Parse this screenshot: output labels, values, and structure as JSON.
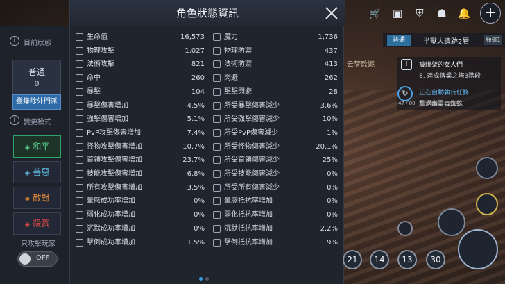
{
  "dialog": {
    "title": "角色狀態資訊",
    "page_dots": 2,
    "active_page": 0
  },
  "left_panel": {
    "status_title": "目前狀態",
    "status_mode": "普通",
    "status_count": "0",
    "register_button": "登錄除外門派",
    "change_mode_title": "變更模式",
    "modes": [
      {
        "label": "和平",
        "color": "#5fd08f",
        "selected": true
      },
      {
        "label": "善惡",
        "color": "#5fb8e0",
        "selected": false
      },
      {
        "label": "敵對",
        "color": "#e88a3a",
        "selected": false
      },
      {
        "label": "殺戮",
        "color": "#e04a4a",
        "selected": false
      }
    ],
    "attack_players_only": "只攻擊玩家",
    "toggle_label": "OFF"
  },
  "stats_left": [
    {
      "label": "生命值",
      "value": "16,573",
      "icon": "heart-icon"
    },
    {
      "label": "物理攻擊",
      "value": "1,027",
      "icon": "sword-icon"
    },
    {
      "label": "法術攻擊",
      "value": "821",
      "icon": "staff-icon"
    },
    {
      "label": "命中",
      "value": "260",
      "icon": "target-icon"
    },
    {
      "label": "暴擊",
      "value": "104",
      "icon": "critical-icon"
    },
    {
      "label": "暴擊傷害增加",
      "value": "4.5%",
      "icon": "critical-damage-icon"
    },
    {
      "label": "強擊傷害增加",
      "value": "5.1%",
      "icon": "strike-icon"
    },
    {
      "label": "PvP攻擊傷害增加",
      "value": "7.4%",
      "icon": "pvp-icon"
    },
    {
      "label": "怪物攻擊傷害增加",
      "value": "10.7%",
      "icon": "monster-icon"
    },
    {
      "label": "首領攻擊傷害增加",
      "value": "23.7%",
      "icon": "boss-icon"
    },
    {
      "label": "技能攻擊傷害增加",
      "value": "6.8%",
      "icon": "skill-icon"
    },
    {
      "label": "所有攻擊傷害增加",
      "value": "3.5%",
      "icon": "all-attack-icon"
    },
    {
      "label": "暈厥成功率增加",
      "value": "0%",
      "icon": "stun-icon"
    },
    {
      "label": "弱化成功率增加",
      "value": "0%",
      "icon": "weaken-icon"
    },
    {
      "label": "沉默成功率增加",
      "value": "0%",
      "icon": "silence-icon"
    },
    {
      "label": "擊倒成功率增加",
      "value": "1.5%",
      "icon": "knockdown-icon"
    }
  ],
  "stats_right": [
    {
      "label": "魔力",
      "value": "1,736",
      "icon": "mana-icon"
    },
    {
      "label": "物理防禦",
      "value": "437",
      "icon": "shield-icon"
    },
    {
      "label": "法術防禦",
      "value": "413",
      "icon": "magic-shield-icon"
    },
    {
      "label": "閃避",
      "value": "262",
      "icon": "dodge-icon"
    },
    {
      "label": "擊擊閃避",
      "value": "28",
      "icon": "critical-dodge-icon"
    },
    {
      "label": "所受暴擊傷害減少",
      "value": "3.6%",
      "icon": "shield-icon"
    },
    {
      "label": "所受強擊傷害減少",
      "value": "10%",
      "icon": "shield-icon"
    },
    {
      "label": "所受PvP傷害減少",
      "value": "1%",
      "icon": "shield-icon"
    },
    {
      "label": "所受怪物傷害減少",
      "value": "20.1%",
      "icon": "shield-icon"
    },
    {
      "label": "所受首領傷害減少",
      "value": "25%",
      "icon": "shield-icon"
    },
    {
      "label": "所受技能傷害減少",
      "value": "0%",
      "icon": "shield-icon"
    },
    {
      "label": "所受所有傷害減少",
      "value": "0%",
      "icon": "shield-icon"
    },
    {
      "label": "暈厥抵抗率增加",
      "value": "0%",
      "icon": "stun-resist-icon"
    },
    {
      "label": "弱化抵抗率增加",
      "value": "0%",
      "icon": "weaken-resist-icon"
    },
    {
      "label": "沉默抵抗率增加",
      "value": "2.2%",
      "icon": "silence-resist-icon"
    },
    {
      "label": "擊倒抵抗率增加",
      "value": "9%",
      "icon": "knockdown-resist-icon"
    }
  ],
  "hud": {
    "zone_tag": "普通",
    "zone_name": "半獸人遺跡2層",
    "zone_channel": "頻道1",
    "player_name": "云梦欧妮",
    "quest1_title": "被綁架的女人們",
    "quest1_step": "8.  達成傳業之塔3階段",
    "quest2_title": "正在自動執行任務",
    "quest2_step": "擊退幽靈毒蜘蛛",
    "quest2_count": "47 / 80",
    "slots": [
      "21",
      "14",
      "13",
      "30"
    ]
  }
}
